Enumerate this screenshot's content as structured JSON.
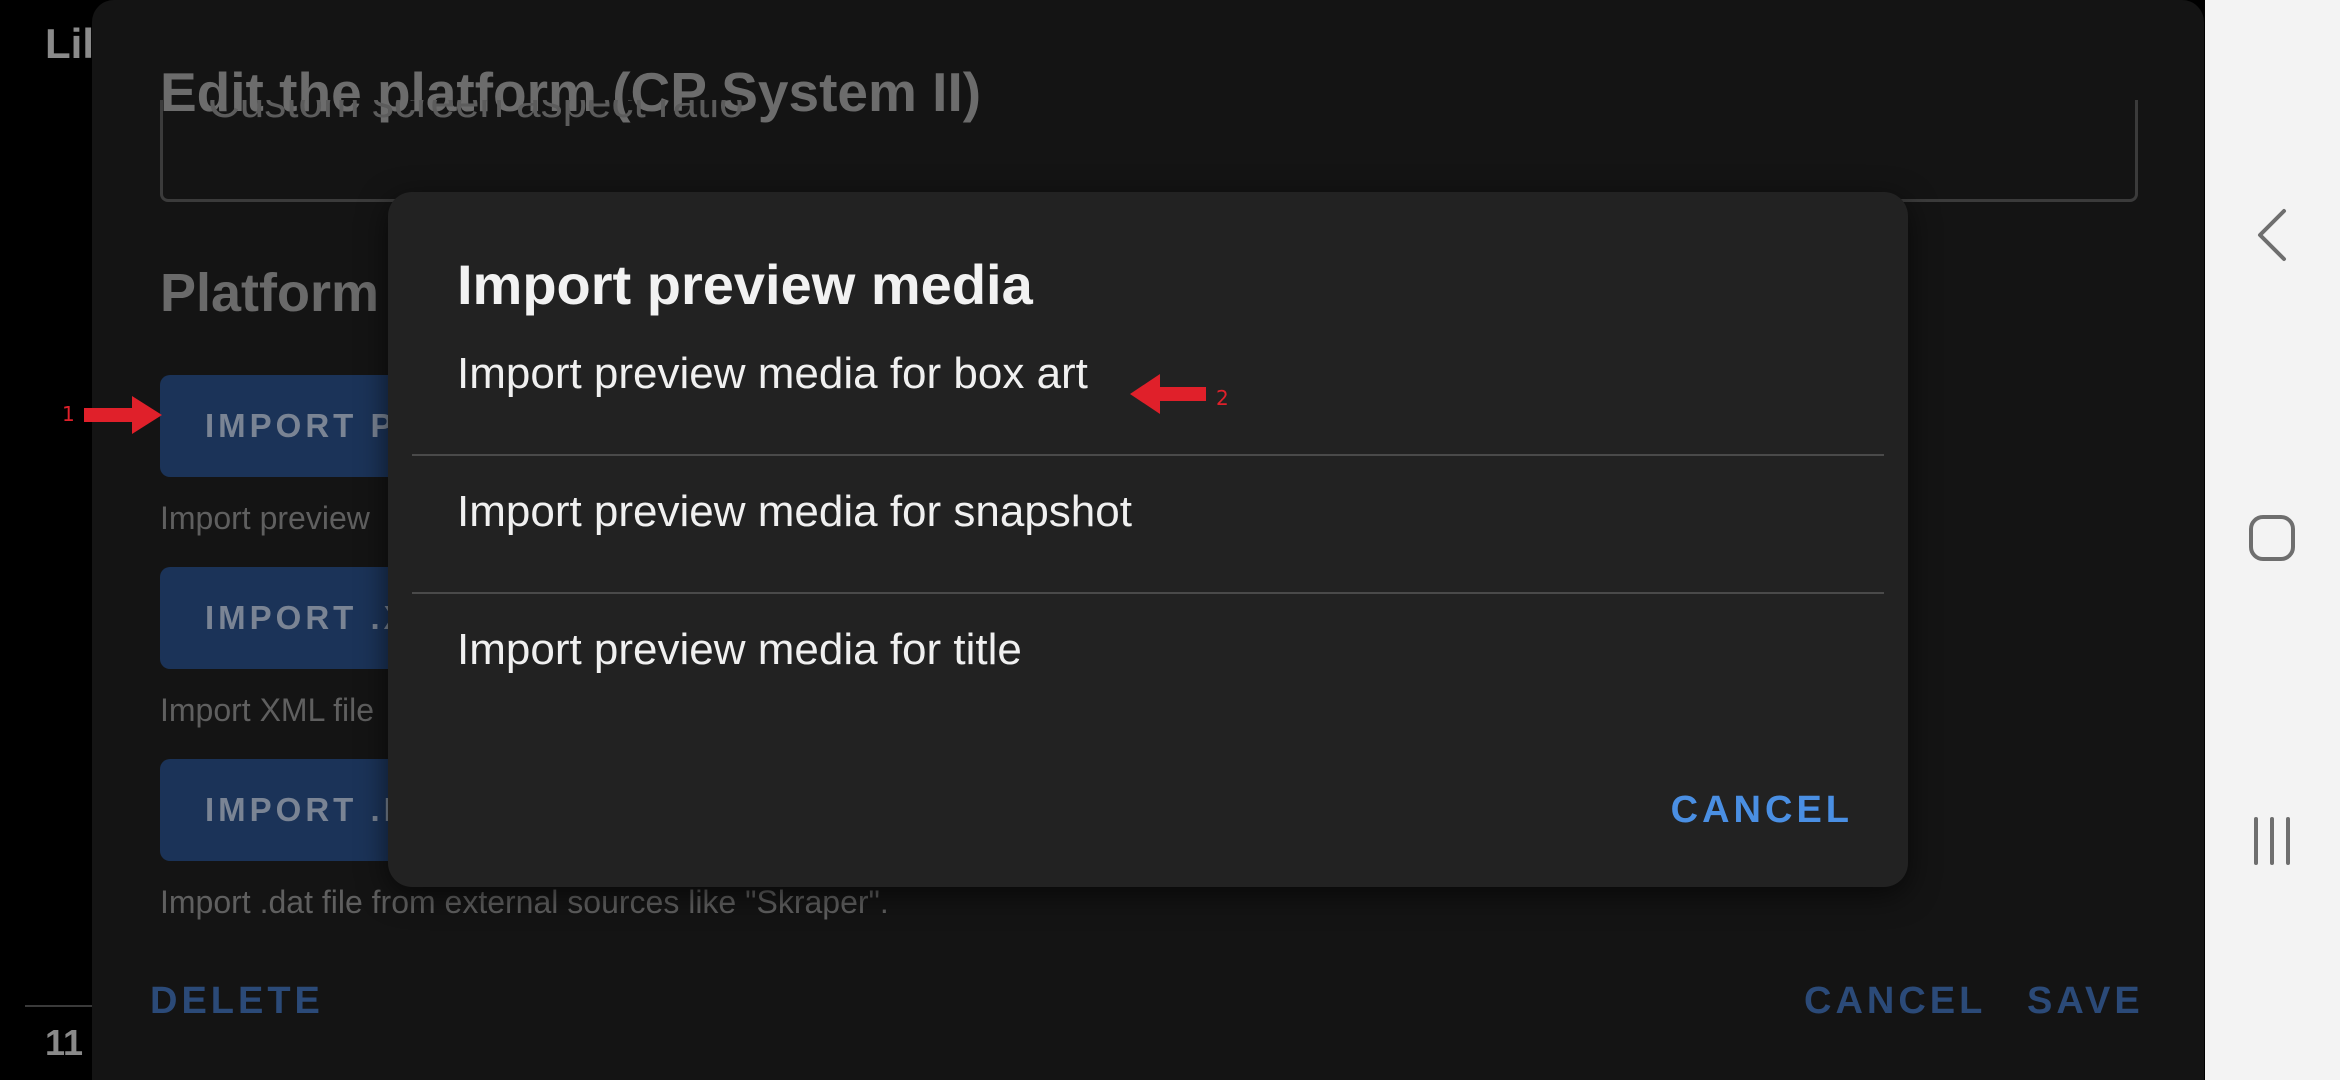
{
  "background": {
    "top_left_text": "Lil",
    "bottom_left_text": "11"
  },
  "edit_panel": {
    "title": "Edit the platform (CP System II)",
    "aspect_placeholder": "Custom screen aspect ratio",
    "section_heading": "Platform",
    "buttons": {
      "import_preview": "IMPORT P",
      "import_xml": "IMPORT .X",
      "import_dat": "IMPORT .D"
    },
    "help": {
      "import_preview": "Import preview",
      "import_xml": "Import XML file",
      "import_dat": "Import .dat file from external sources like \"Skraper\"."
    },
    "actions": {
      "delete": "DELETE",
      "cancel": "CANCEL",
      "save": "SAVE"
    }
  },
  "annotations": {
    "arrow_1_label": "1",
    "arrow_2_label": "2",
    "color": "#e0202a"
  },
  "dialog": {
    "title": "Import preview media",
    "options": [
      "Import preview media for box art",
      "Import preview media for snapshot",
      "Import preview media for title"
    ],
    "cancel": "CANCEL",
    "accent": "#4a8fe3"
  },
  "nav_bar": {
    "icons": [
      "back-icon",
      "home-icon",
      "recents-icon"
    ]
  }
}
